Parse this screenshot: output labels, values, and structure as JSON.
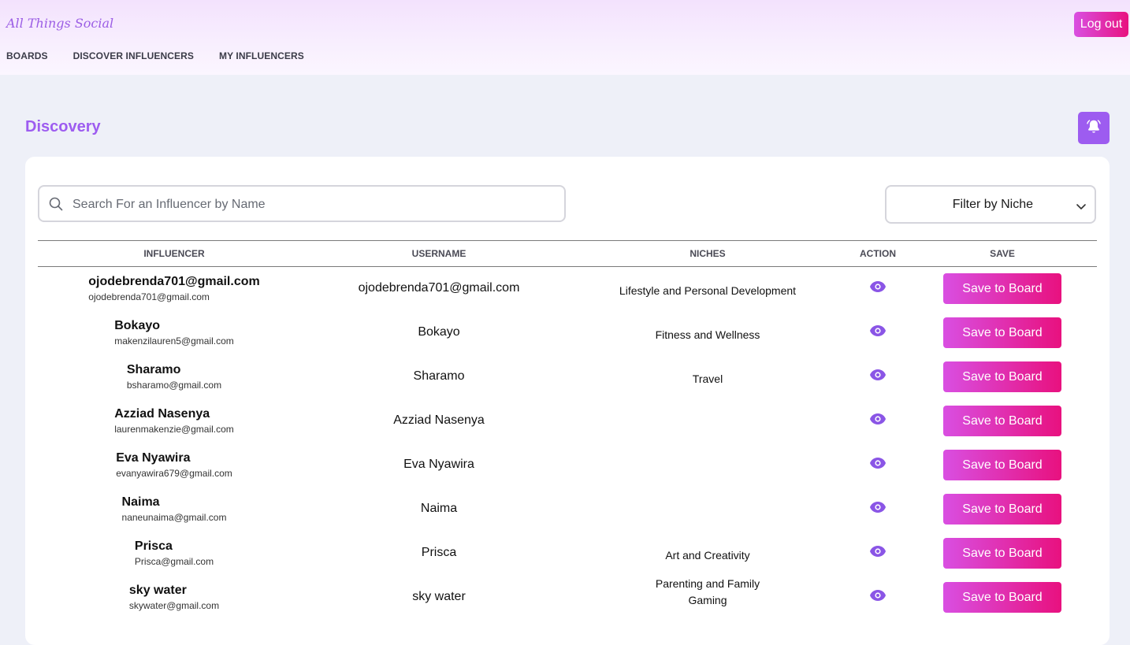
{
  "header": {
    "brand": "All Things Social",
    "logout_label": "Log out",
    "nav": [
      "BOARDS",
      "DISCOVER INFLUENCERS",
      "MY INFLUENCERS"
    ]
  },
  "page": {
    "title": "Discovery",
    "notification_icon": "bell-icon"
  },
  "search": {
    "placeholder": "Search For an Influencer by Name",
    "value": ""
  },
  "filter": {
    "label": "Filter by Niche"
  },
  "table": {
    "columns": [
      "INFLUENCER",
      "USERNAME",
      "NICHES",
      "ACTION",
      "SAVE"
    ],
    "save_label": "Save to Board",
    "action_icon": "eye-icon",
    "rows": [
      {
        "name": "ojodebrenda701@gmail.com",
        "email": "ojodebrenda701@gmail.com",
        "username": "ojodebrenda701@gmail.com",
        "niches": [
          "Lifestyle and Personal Development"
        ]
      },
      {
        "name": "Bokayo",
        "email": "makenzilauren5@gmail.com",
        "username": "Bokayo",
        "niches": [
          "Fitness and Wellness"
        ]
      },
      {
        "name": "Sharamo",
        "email": "bsharamo@gmail.com",
        "username": "Sharamo",
        "niches": [
          "Travel"
        ]
      },
      {
        "name": "Azziad Nasenya",
        "email": "laurenmakenzie@gmail.com",
        "username": "Azziad Nasenya",
        "niches": []
      },
      {
        "name": "Eva Nyawira",
        "email": "evanyawira679@gmail.com",
        "username": "Eva Nyawira",
        "niches": []
      },
      {
        "name": "Naima",
        "email": "naneunaima@gmail.com",
        "username": "Naima",
        "niches": []
      },
      {
        "name": "Prisca",
        "email": "Prisca@gmail.com",
        "username": "Prisca",
        "niches": [
          "Art and Creativity"
        ]
      },
      {
        "name": "sky water",
        "email": "skywater@gmail.com",
        "username": "sky water",
        "niches": [
          "Parenting and Family",
          "Gaming"
        ]
      }
    ]
  },
  "colors": {
    "accent": "#9d5cf0",
    "button_gradient_start": "#d94fe2",
    "button_gradient_end": "#e8117f",
    "page_bg": "#eef0f8"
  }
}
